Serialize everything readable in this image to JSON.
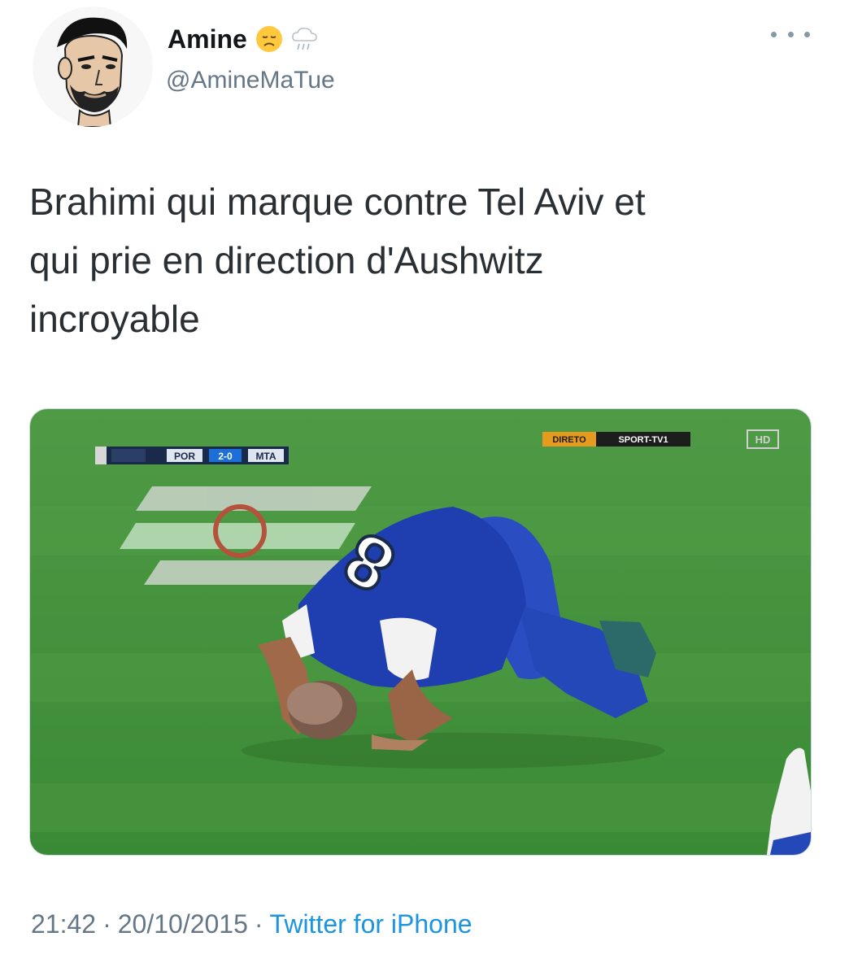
{
  "user": {
    "display_name": "Amine",
    "handle": "@AmineMaTue",
    "emoji_1": "disappointed-face-emoji",
    "emoji_2": "cloud-rain-emoji"
  },
  "tweet": {
    "text_lines": [
      "Brahimi qui marque contre Tel Aviv et",
      "qui prie en direction d'Aushwitz",
      "incroyable"
    ]
  },
  "media": {
    "scoreboard": [
      "POR",
      "2-0",
      "MTA"
    ],
    "broadcaster_live": "DIRETO",
    "broadcaster_channel": "SPORT-TV1",
    "hd_badge": "HD",
    "jersey_number": "8"
  },
  "meta": {
    "time": "21:42",
    "date": "20/10/2015",
    "source": "Twitter for iPhone",
    "separator": "·"
  },
  "colors": {
    "text": "#14171a",
    "secondary": "#657786",
    "link": "#1b95e0",
    "pitch": "#3f8f3a",
    "jersey": "#1f3fb0"
  },
  "icons": {
    "more": "more-options-icon"
  }
}
